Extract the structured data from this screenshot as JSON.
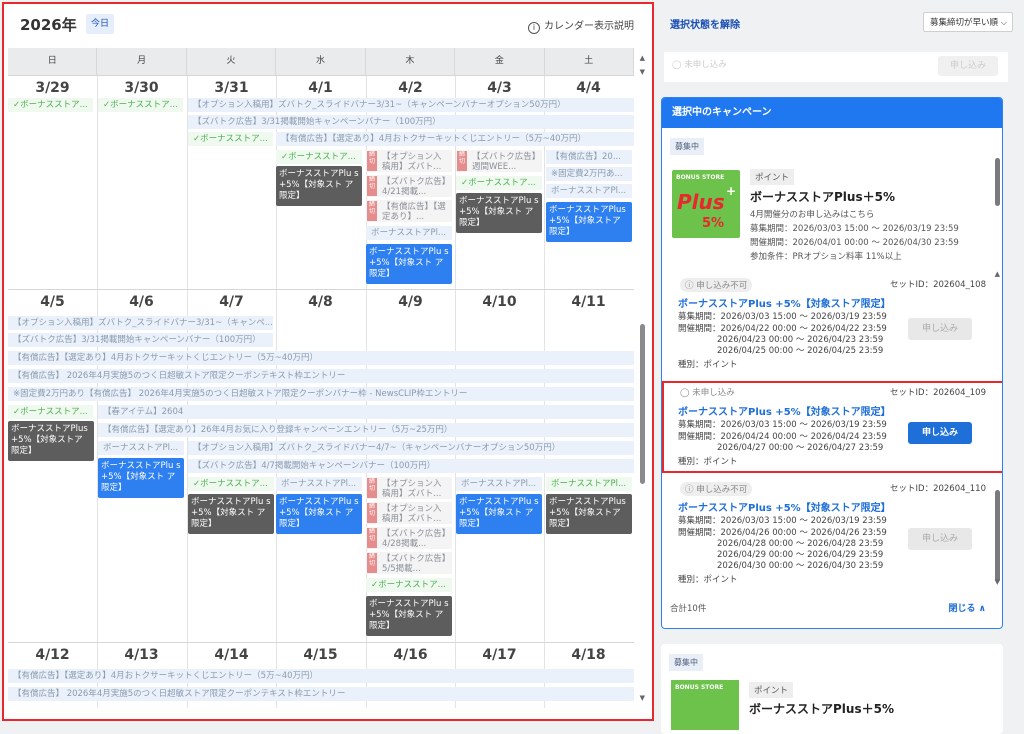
{
  "calendar": {
    "year": "2026年",
    "today_label": "今日",
    "help_label": "カレンダー表示説明",
    "weekdays": [
      "日",
      "月",
      "火",
      "水",
      "木",
      "金",
      "土"
    ],
    "week1_dates": [
      "3/29",
      "3/30",
      "3/31",
      "4/1",
      "4/2",
      "4/3",
      "4/4"
    ],
    "week2_dates": [
      "4/5",
      "4/6",
      "4/7",
      "4/8",
      "4/9",
      "4/10",
      "4/11"
    ],
    "week3_dates": [
      "4/12",
      "4/13",
      "4/14",
      "4/15",
      "4/16",
      "4/17",
      "4/18"
    ],
    "ev_bonus_short": "✓ボーナスストア...",
    "ev_bonus_short2": "✓ボーナスストア...",
    "ev_bonus_pl": "ボーナスストアPl...",
    "ev_option_banner_331": "【オプション入稿用】ズバトク_スライドバナー3/31~（キャンペーンバナーオプション50万円）",
    "ev_zubatoku_331": "【ズバトク広告】3/31掲載開始キャンペーンバナー（100万円）",
    "ev_paid_ad_sale": "【有償広告】【選定あり】4月おトクサーキットくじエントリー（5万~40万円）",
    "card_plus_text": "ボーナスストアPlus +5%【対象ストア限定】",
    "card_plus_text_b": "ボーナスストアPlu s +5%【対象スト ア限定】",
    "ev_option_short": "【オプション入稿用】ズバト...",
    "ev_zubatoku_421": "【ズバトク広告】4/21掲載...",
    "ev_paid_short": "【有償広告】【選定あり】...",
    "ev_zubatoku_wee": "【ズバトク広告】週間WEE...",
    "ev_paid_20": "【有償広告】20...",
    "ev_fixed_short": "※固定費2万円あ...",
    "ev_option_banner_331b": "【オプション入稿用】ズバトク_スライドバナー3/31~（キャンペ...",
    "ev_zubatoku_331b": "【ズバトク広告】3/31掲載開始キャンペーンバナー（100万円）",
    "ev_paid_ad_2026": "【有償広告】 2026年4月実施5のつく日超敏ストア限定クーポンテキスト枠エントリー",
    "ev_paid_ad_sale2": "【有償広告】【選定あり】4月おトクサーキットくじエントリー（5万~40万円）",
    "ev_fixed_newsclip": "※固定費2万円あり【有償広告】 2026年4月実施5のつく日超敏ストア限定クーポンバナー枠 - NewsCLIP枠エントリー",
    "ev_spring_item": "【春アイテム】2604",
    "ev_paid_fav": "【有償広告】【選定あり】26年4月お気に入り登録キャンペーンエントリー（5万~25万円）",
    "ev_option_banner_47": "【オプション入稿用】ズバトク_スライドバナー4/7~（キャンペーンバナーオプション50万円）",
    "ev_zubatoku_47": "【ズバトク広告】4/7掲載開始キャンペーンバナー（100万円）",
    "ev_zubatoku_428": "【ズバトク広告】4/28掲載...",
    "ev_zubatoku_55": "【ズバトク広告】5/5掲載...",
    "ev_paid_ad_sale3": "【有償広告】【選定あり】4月おトクサーキットくじエントリー（5万~40万円）",
    "ev_paid_ad_2026b": "【有償広告】 2026年4月実施5のつく日超敏ストア限定クーポンテキスト枠エントリー",
    "tag_label": "締切"
  },
  "panel": {
    "clear_selection": "選択状態を解除",
    "sort_label": "募集締切が早い順",
    "ghost_status": "未申し込み",
    "ghost_apply": "申し込み",
    "selected_header": "選択中のキャンペーン",
    "recruiting_tag": "募集中",
    "img_store_label": "BONUS STORE",
    "img_big": "Plus",
    "img_plus_sign": "+",
    "img_pct": "5%",
    "point_badge": "ポイント",
    "campaign_title": "ボーナスストアPlus＋5%",
    "campaign_sub": "4月開催分のお申し込みはこちら",
    "recruit_period": "募集期間：2026/03/03 15:00 ～ 2026/03/19 23:59",
    "event_period": "開催期間：2026/04/01 00:00 ～ 2026/04/30 23:59",
    "condition": "参加条件：PRオプション料率 11%以上",
    "sets": [
      {
        "status": "申し込み不可",
        "set_id": "セットID：202604_108",
        "title": "ボーナスストアPlus +5%【対象ストア限定】",
        "recruit": "募集期間：2026/03/03 15:00 ～ 2026/03/19 23:59",
        "event_lines": [
          "開催期間：2026/04/22 00:00 ～ 2026/04/22 23:59",
          "2026/04/23 00:00 ～ 2026/04/23 23:59",
          "2026/04/25 00:00 ～ 2026/04/25 23:59"
        ],
        "kind": "種別：ポイント",
        "apply": "申し込み"
      },
      {
        "status": "未申し込み",
        "set_id": "セットID：202604_109",
        "title": "ボーナスストアPlus +5%【対象ストア限定】",
        "recruit": "募集期間：2026/03/03 15:00 ～ 2026/03/19 23:59",
        "event_lines": [
          "開催期間：2026/04/24 00:00 ～ 2026/04/24 23:59",
          "2026/04/27 00:00 ～ 2026/04/27 23:59"
        ],
        "kind": "種別：ポイント",
        "apply": "申し込み"
      },
      {
        "status": "申し込み不可",
        "set_id": "セットID：202604_110",
        "title": "ボーナスストアPlus +5%【対象ストア限定】",
        "recruit": "募集期間：2026/03/03 15:00 ～ 2026/03/19 23:59",
        "event_lines": [
          "開催期間：2026/04/26 00:00 ～ 2026/04/26 23:59",
          "2026/04/28 00:00 ～ 2026/04/28 23:59",
          "2026/04/29 00:00 ～ 2026/04/29 23:59",
          "2026/04/30 00:00 ～ 2026/04/30 23:59"
        ],
        "kind": "種別：ポイント",
        "apply": "申し込み"
      }
    ],
    "total": "合計10件",
    "close_label": "閉じる ∧",
    "next_recruiting_tag": "募集中",
    "next_point_badge": "ポイント",
    "next_title_partial": "ボーナスストアPlus＋5%"
  }
}
